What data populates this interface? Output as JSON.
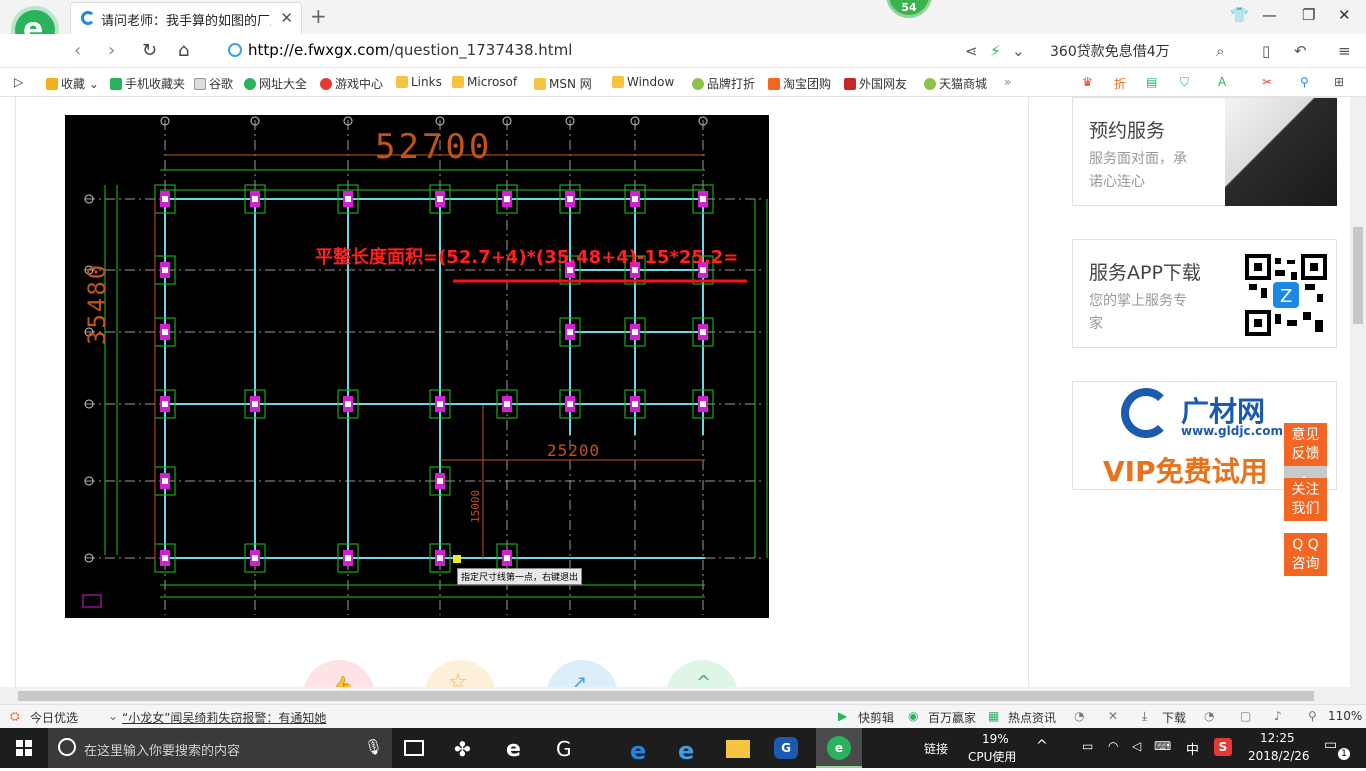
{
  "browser": {
    "tab_title": "请问老师：我手算的如图的厂房的",
    "badge": "54",
    "url_host": "http://e.fwxgx.com",
    "url_path": "/question_1737438.html",
    "search_text": "360贷款免息借4万"
  },
  "bookmarks": [
    {
      "label": "收藏",
      "color": "#f2b01e"
    },
    {
      "label": "手机收藏夹",
      "color": "#2ab35c"
    },
    {
      "label": "谷歌",
      "color": "#ddd"
    },
    {
      "label": "网址大全",
      "color": "#2ab35c"
    },
    {
      "label": "游戏中心",
      "color": "#e53935"
    },
    {
      "label": "Links",
      "color": "#f5c542"
    },
    {
      "label": "Microsof",
      "color": "#f5c542"
    },
    {
      "label": "MSN 网",
      "color": "#f5c542"
    },
    {
      "label": "Window",
      "color": "#f5c542"
    },
    {
      "label": "品牌打折",
      "color": "#8bc34a"
    },
    {
      "label": "淘宝团购",
      "color": "#f26522"
    },
    {
      "label": "外国网友",
      "color": "#c62828"
    },
    {
      "label": "天猫商城",
      "color": "#8bc34a"
    }
  ],
  "cad": {
    "formula": "平整长度面积=(52.7+4)*(35.48+4)-15*25.2=",
    "dim_top": "52700",
    "dim_left": "35480",
    "dim_mid": "25200",
    "dim_vert": "15000",
    "prompt": "指定尺寸线第一点，右键退出"
  },
  "sidebar": {
    "card1_title": "预约服务",
    "card1_line1": "服务面对面，承",
    "card1_line2": "诺心连心",
    "card2_title": "服务APP下载",
    "card2_line1": "您的掌上服务专",
    "card2_line2": "家",
    "brand_name": "广材网",
    "brand_url": "www.gldjc.com",
    "brand_vip": "VIP免费试用"
  },
  "float_buttons": {
    "feedback": [
      "意见",
      "反馈"
    ],
    "follow": [
      "关注",
      "我们"
    ],
    "qq": [
      "Q Q",
      "咨询"
    ]
  },
  "statusbar": {
    "today": "今日优选",
    "news": "“小龙女”闻吴绮莉失窃报警：有通知她",
    "kuaijianji": "快剪辑",
    "baiwan": "百万赢家",
    "redian": "热点资讯",
    "download": "下载",
    "zoom": "110%"
  },
  "taskbar": {
    "search_placeholder": "在这里输入你要搜索的内容",
    "links_label": "链接",
    "cpu_percent": "19%",
    "cpu_label": "CPU使用",
    "ime": "中",
    "time": "12:25",
    "date": "2018/2/26",
    "notif": "1"
  }
}
